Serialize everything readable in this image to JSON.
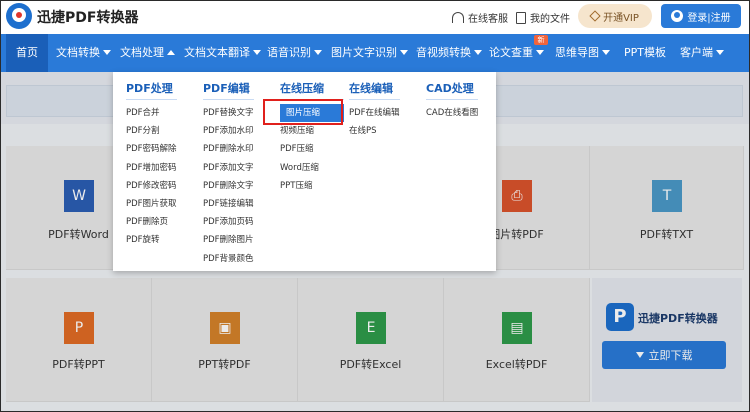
{
  "header": {
    "app_title": "迅捷PDF转换器",
    "service_label": "在线客服",
    "files_label": "我的文件",
    "vip_label": "开通VIP",
    "login_label": "登录|注册"
  },
  "nav": {
    "items": [
      {
        "label": "首页"
      },
      {
        "label": "文档转换"
      },
      {
        "label": "文档处理"
      },
      {
        "label": "文档文本翻译"
      },
      {
        "label": "语音识别"
      },
      {
        "label": "图片文字识别"
      },
      {
        "label": "音视频转换"
      },
      {
        "label": "论文查重"
      },
      {
        "label": "思维导图"
      },
      {
        "label": "PPT模板"
      },
      {
        "label": "客户端"
      }
    ],
    "badge": "新"
  },
  "dropdown": {
    "columns": [
      {
        "title": "PDF处理",
        "items": [
          "PDF合并",
          "PDF分割",
          "PDF密码解除",
          "PDF增加密码",
          "PDF修改密码",
          "PDF图片获取",
          "PDF删除页",
          "PDF旋转"
        ]
      },
      {
        "title": "PDF编辑",
        "items": [
          "PDF替换文字",
          "PDF添加水印",
          "PDF删除水印",
          "PDF添加文字",
          "PDF删除文字",
          "PDF链接编辑",
          "PDF添加页码",
          "PDF删除图片",
          "PDF背景颜色"
        ]
      },
      {
        "title": "在线压缩",
        "items": [
          "图片压缩",
          "视频压缩",
          "PDF压缩",
          "Word压缩",
          "PPT压缩"
        ]
      },
      {
        "title": "在线编辑",
        "items": [
          "PDF在线编辑",
          "在线PS"
        ]
      },
      {
        "title": "CAD处理",
        "items": [
          "CAD在线看图"
        ]
      }
    ],
    "selected": "图片压缩"
  },
  "cards_row1": [
    "PDF转Word",
    "图片转PDF",
    "PDF转TXT"
  ],
  "cards_row2": [
    "PDF转PPT",
    "PPT转PDF",
    "PDF转Excel",
    "Excel转PDF"
  ],
  "promo": {
    "title": "迅捷PDF转换器",
    "download_label": "立即下载"
  },
  "colors": {
    "primary": "#2a7ad8",
    "nav_active": "#1a5fb8",
    "highlight": "#e0201c"
  }
}
